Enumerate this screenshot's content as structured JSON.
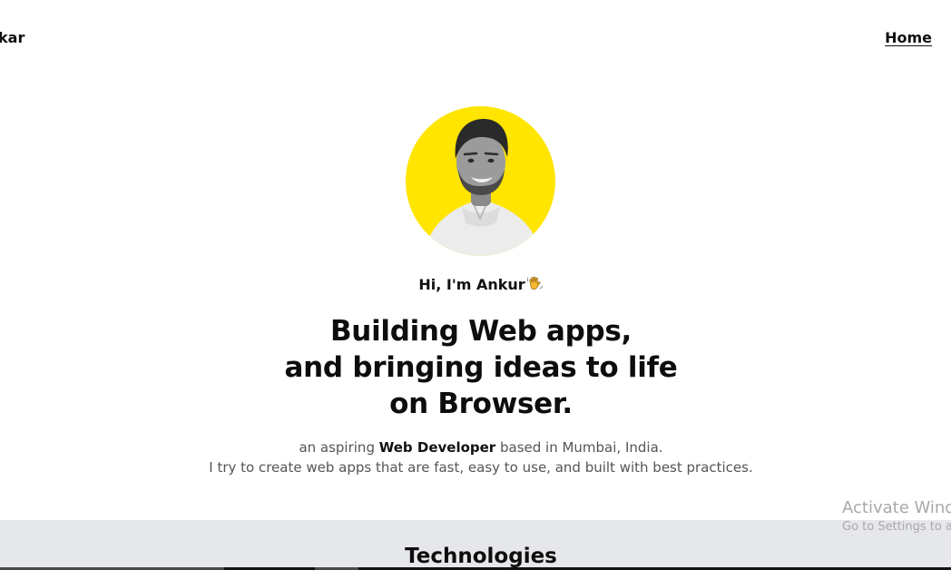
{
  "header": {
    "brand": "kar",
    "nav": [
      {
        "label": "Home"
      }
    ]
  },
  "hero": {
    "avatar": {
      "icon": "profile-photo",
      "background": "#ffe500"
    },
    "greeting": "Hi, I'm Ankur",
    "greeting_icon": "waving-hand-icon",
    "headline_lines": [
      "Building Web apps,",
      "and bringing ideas to life",
      "on Browser."
    ],
    "intro": {
      "pre": "an aspiring ",
      "highlight": "Web Developer",
      "post": " based in Mumbai, India.",
      "line2": "I try to create web apps that are fast, easy to use, and built with best practices."
    }
  },
  "watermark": {
    "title": "Activate Windows",
    "subtitle": "Go to Settings to activate Windows."
  },
  "technologies": {
    "title": "Technologies"
  },
  "colors": {
    "accent": "#ffe500",
    "section_bg": "#e6e7ea"
  }
}
